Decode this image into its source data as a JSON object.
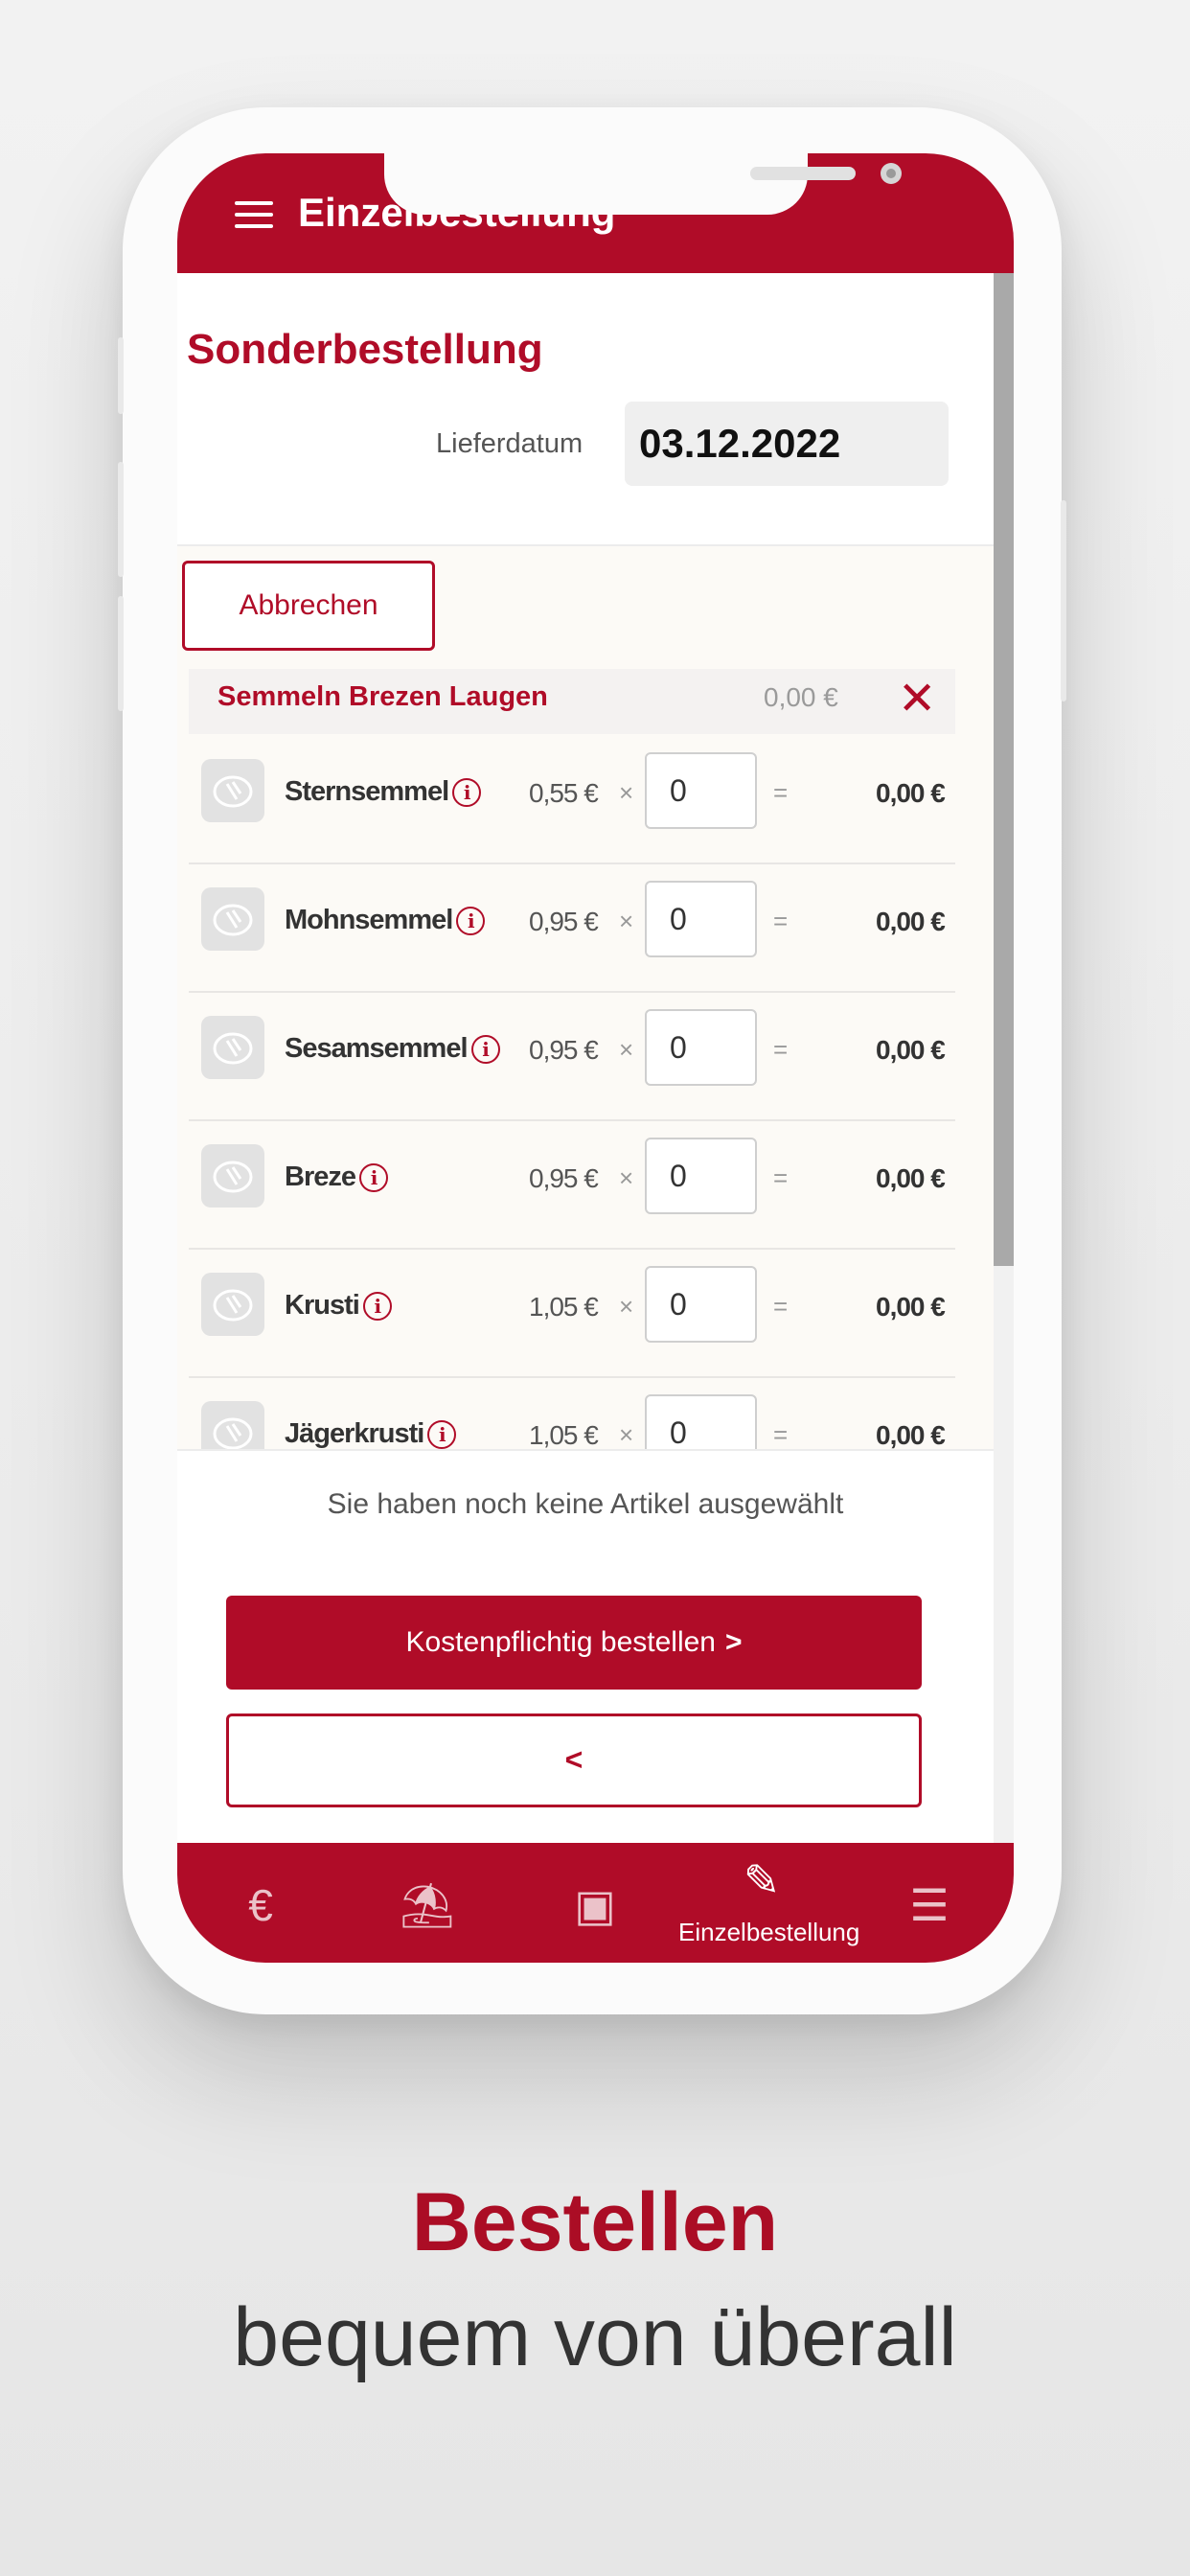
{
  "app_bar": {
    "title": "Einzelbestellung"
  },
  "page": {
    "title": "Sonderbestellung",
    "delivery_date_label": "Lieferdatum",
    "delivery_date_value": "03.12.2022",
    "cancel_label": "Abbrechen"
  },
  "category": {
    "name": "Semmeln Brezen Laugen",
    "total": "0,00 €",
    "close_symbol": "✕"
  },
  "products": [
    {
      "name": "Sternsemmel",
      "price": "0,55 €",
      "quantity": "0",
      "total": "0,00 €"
    },
    {
      "name": "Mohnsemmel",
      "price": "0,95 €",
      "quantity": "0",
      "total": "0,00 €"
    },
    {
      "name": "Sesamsemmel",
      "price": "0,95 €",
      "quantity": "0",
      "total": "0,00 €"
    },
    {
      "name": "Breze",
      "price": "0,95 €",
      "quantity": "0",
      "total": "0,00 €"
    },
    {
      "name": "Krusti",
      "price": "1,05 €",
      "quantity": "0",
      "total": "0,00 €"
    },
    {
      "name": "Jägerkrusti",
      "price": "1,05 €",
      "quantity": "0",
      "total": "0,00 €"
    }
  ],
  "symbols": {
    "times": "×",
    "equals": "="
  },
  "footer": {
    "empty_message": "Sie haben noch keine Artikel ausgewählt",
    "order_button_label": "Kostenpflichtig bestellen",
    "order_button_chevron": ">",
    "back_button_label": "<"
  },
  "bottom_nav": [
    {
      "icon": "euro-icon",
      "glyph": "€"
    },
    {
      "icon": "beach-umbrella-icon",
      "glyph": "⛱"
    },
    {
      "icon": "subscriptions-icon",
      "glyph": "▣"
    },
    {
      "icon": "new-order-icon",
      "glyph": "✎",
      "label": "Einzelbestellung",
      "active": true
    },
    {
      "icon": "order-list-icon",
      "glyph": "☰"
    }
  ],
  "promo": {
    "headline": "Bestellen",
    "subline": "bequem von überall"
  },
  "colors": {
    "brand_red": "#b00c28",
    "headline_red": "#ab0d25"
  }
}
